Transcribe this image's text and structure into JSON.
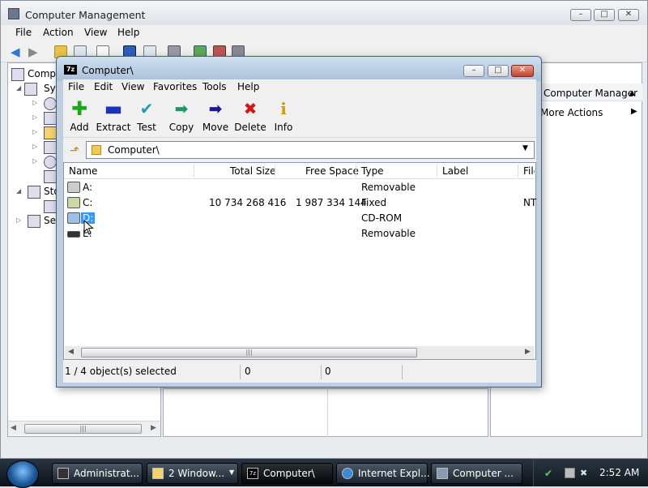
{
  "cm": {
    "title": "Computer Management",
    "menu": [
      "File",
      "Action",
      "View",
      "Help"
    ],
    "tree": [
      {
        "label": "Computer"
      },
      {
        "label": "System Tools"
      },
      {
        "label": ""
      },
      {
        "label": ""
      },
      {
        "label": ""
      },
      {
        "label": ""
      },
      {
        "label": ""
      },
      {
        "label": ""
      },
      {
        "label": "Storage"
      },
      {
        "label": ""
      },
      {
        "label": "Services"
      }
    ],
    "actions": {
      "header": "Computer Manager",
      "sub": "More Actions"
    }
  },
  "z": {
    "title": "Computer\\",
    "menu": [
      "File",
      "Edit",
      "View",
      "Favorites",
      "Tools",
      "Help"
    ],
    "toolbar": [
      {
        "label": "Add",
        "icon": "plus-icon",
        "color": "#1aa81a"
      },
      {
        "label": "Extract",
        "icon": "minus-icon",
        "color": "#1a33b8"
      },
      {
        "label": "Test",
        "icon": "check-icon",
        "color": "#1aa0b0"
      },
      {
        "label": "Copy",
        "icon": "copy-arrow-icon",
        "color": "#1a9a60"
      },
      {
        "label": "Move",
        "icon": "move-arrow-icon",
        "color": "#1a1a90"
      },
      {
        "label": "Delete",
        "icon": "x-icon",
        "color": "#d01818"
      },
      {
        "label": "Info",
        "icon": "info-icon",
        "color": "#c8a000"
      }
    ],
    "address": "Computer\\",
    "columns": [
      "Name",
      "Total Size",
      "Free Space",
      "Type",
      "Label",
      "File System"
    ],
    "rows": [
      {
        "name": "A:",
        "total": "",
        "free": "",
        "type": "Removable",
        "fs": ""
      },
      {
        "name": "C:",
        "total": "10 734 268 416",
        "free": "1 987 334 144",
        "type": "Fixed",
        "fs": "NT"
      },
      {
        "name": "D:",
        "total": "",
        "free": "",
        "type": "CD-ROM",
        "fs": ""
      },
      {
        "name": "E:",
        "total": "",
        "free": "",
        "type": "Removable",
        "fs": ""
      }
    ],
    "status": {
      "selected": "1 / 4 object(s) selected",
      "size": "0",
      "packed": "0"
    }
  },
  "taskbar": {
    "tasks": [
      "Administrat...",
      "2 Window...",
      "Computer\\",
      "Internet Expl...",
      "Computer ..."
    ],
    "clock": "2:52 AM"
  },
  "colors": {
    "selection": "#3399ff",
    "close_button": "#c4422c"
  }
}
